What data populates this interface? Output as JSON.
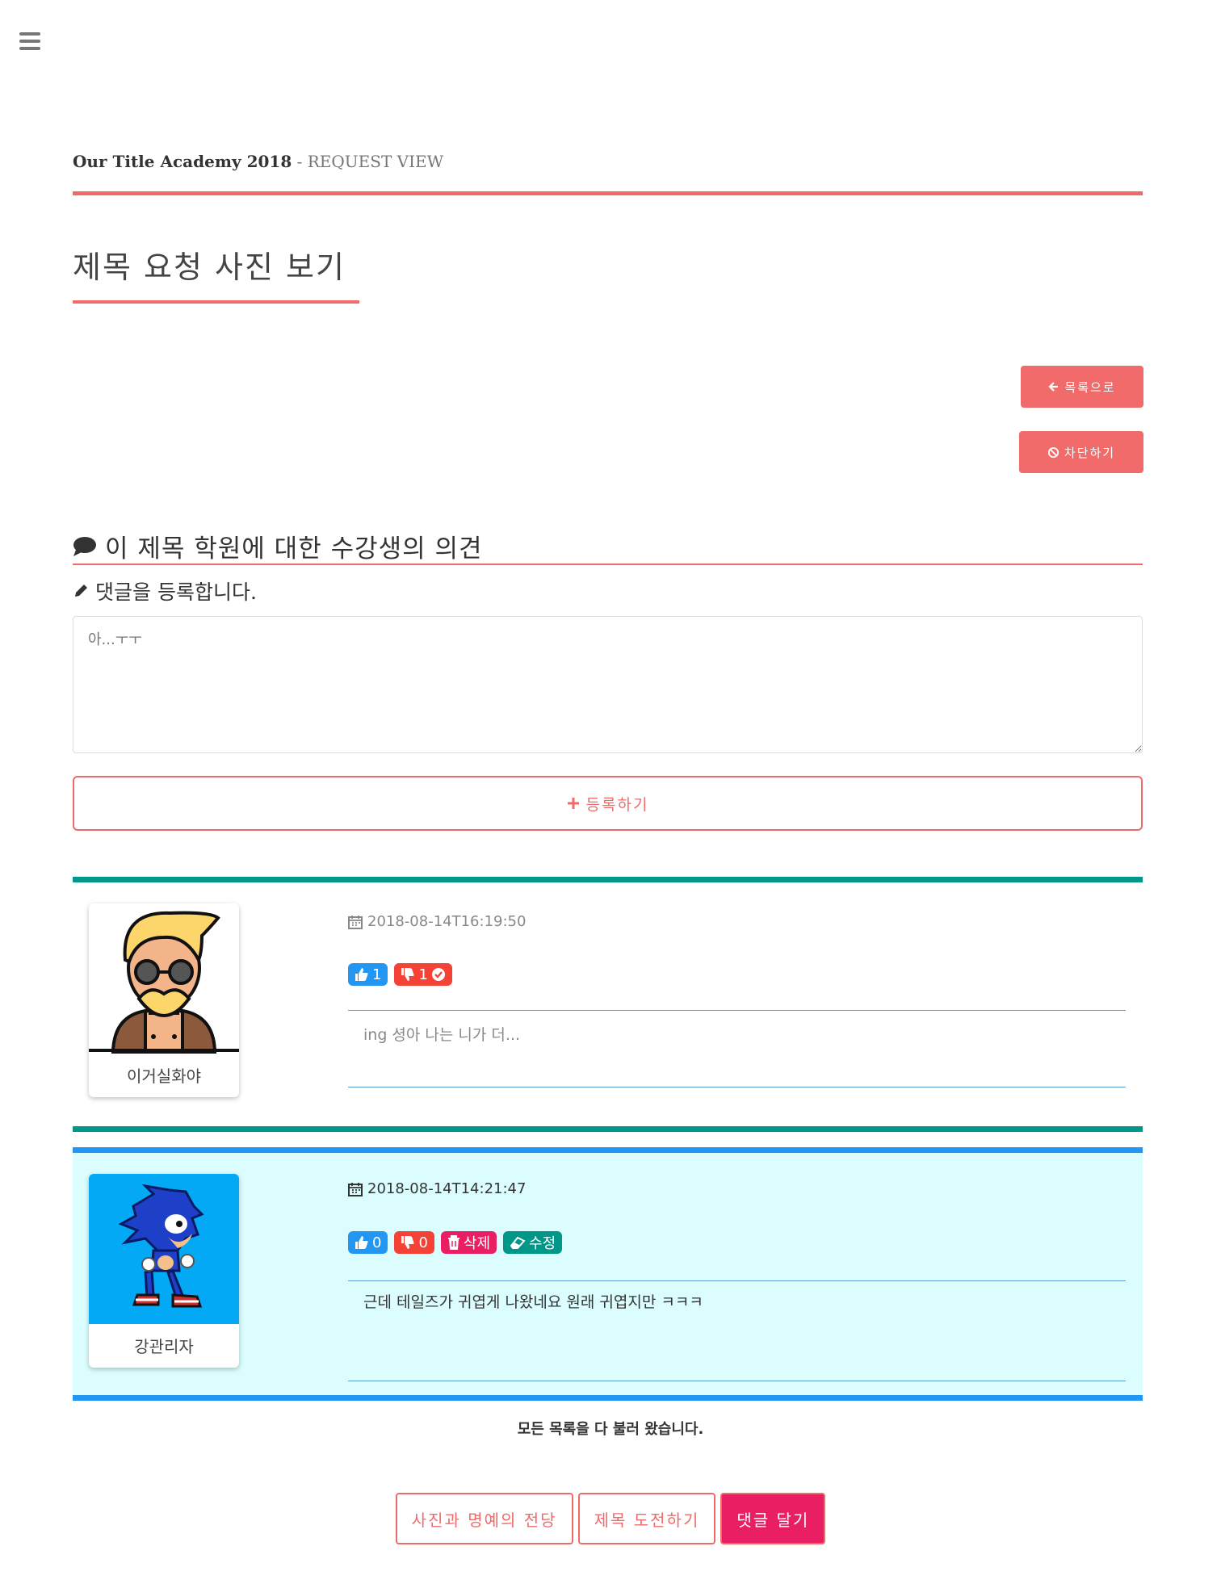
{
  "header": {
    "menu_icon": "bars-icon",
    "brand": "Our Title Academy 2018",
    "separator": " - ",
    "section": "REQUEST VIEW"
  },
  "page": {
    "title": "제목 요청 사진 보기"
  },
  "actions": {
    "back_label": "목록으로",
    "block_label": "차단하기"
  },
  "comments_section": {
    "title": "이 제목 학원에 대한 수강생의 의견",
    "subtitle": "댓글을 등록합니다.",
    "input_placeholder": "아...ㅜㅜ",
    "submit_label": "등록하기"
  },
  "comments": [
    {
      "author": "이거실화야",
      "timestamp": "2018-08-14T16:19:50",
      "likes": "1",
      "dislikes": "1",
      "text": "ing 셩아 나는 니가 더...",
      "accent": "#009688"
    },
    {
      "author": "강관리자",
      "timestamp": "2018-08-14T14:21:47",
      "likes": "0",
      "dislikes": "0",
      "delete_label": "삭제",
      "edit_label": "수정",
      "text": "근데 테일즈가 귀엽게 나왔네요 원래 귀엽지만 ㅋㅋㅋ",
      "accent": "#2196f3",
      "background": "#dbfdfd"
    }
  ],
  "footer": {
    "note": "모든 목록을 다 불러 왔습니다.",
    "buttons": [
      "사진과 명예의 전당",
      "제목 도전하기",
      "댓글 달기"
    ]
  },
  "colors": {
    "primary": "#ef6b6b",
    "teal": "#009688",
    "blue": "#2196f3",
    "pink": "#e91e63",
    "red": "#f44336"
  }
}
